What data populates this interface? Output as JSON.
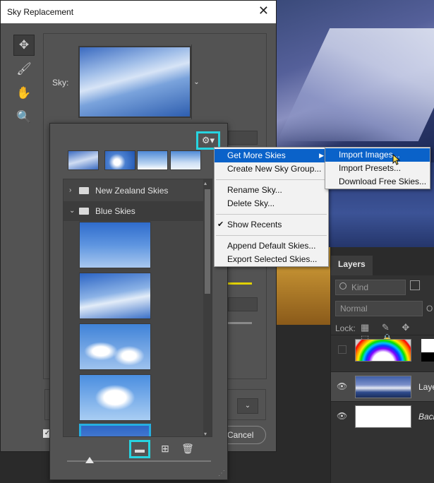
{
  "dialog": {
    "title": "Sky Replacement",
    "close_glyph": "✕",
    "sky_label": "Sky:",
    "cancel_label": "Cancel"
  },
  "tools": [
    "move-tool",
    "sky-brush-tool",
    "hand-tool",
    "zoom-tool"
  ],
  "picker": {
    "groups": [
      {
        "name": "New Zealand Skies",
        "expanded": false
      },
      {
        "name": "Blue Skies",
        "expanded": true
      }
    ]
  },
  "context_menu": {
    "items": [
      {
        "label": "Get More Skies",
        "submenu": true,
        "highlighted": true
      },
      {
        "label": "Create New Sky Group..."
      },
      {
        "label": "Rename Sky..."
      },
      {
        "label": "Delete Sky..."
      },
      {
        "label": "Show Recents",
        "checked": true
      },
      {
        "label": "Append Default Skies..."
      },
      {
        "label": "Export Selected Skies..."
      }
    ]
  },
  "submenu": {
    "items": [
      {
        "label": "Import Images...",
        "highlighted": true
      },
      {
        "label": "Import Presets..."
      },
      {
        "label": "Download Free Skies..."
      }
    ]
  },
  "layers_panel": {
    "tab": "Layers",
    "kind_label": "Kind",
    "blend_mode": "Normal",
    "opacity_prefix": "O",
    "lock_label": "Lock:",
    "layers": [
      {
        "name": "",
        "visible": false
      },
      {
        "name": "Laye",
        "visible": true,
        "selected": true
      },
      {
        "name": "Back",
        "visible": true
      }
    ]
  },
  "colors": {
    "highlight_cyan": "#27d4e0",
    "menu_highlight": "#0a62c9",
    "dialog_bg": "#535353"
  }
}
